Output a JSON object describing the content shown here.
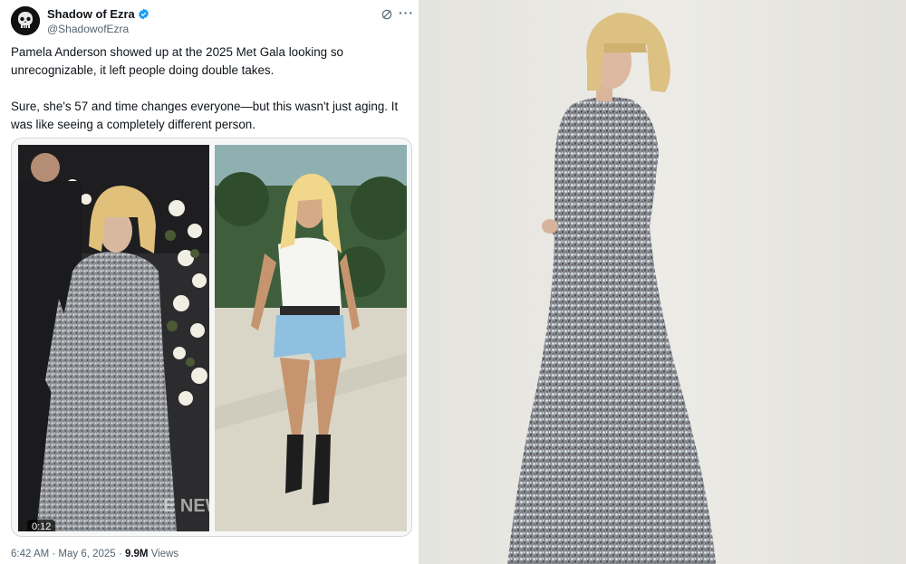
{
  "tweet": {
    "author_name": "Shadow of Ezra",
    "author_handle": "@ShadowofEzra",
    "paragraph_1": "Pamela Anderson showed up at the 2025 Met Gala looking so unrecognizable, it left people doing double takes.",
    "paragraph_2": "Sure, she's 57 and time changes everyone—but this wasn't just aging. It was like seeing a completely different person.",
    "media": {
      "video_duration": "0:12",
      "watermark": "E NEWS"
    },
    "timestamp": "6:42 AM · May 6, 2025",
    "separator": " · ",
    "views_count": "9.9M",
    "views_label": " Views"
  },
  "colors": {
    "verified": "#1d9bf0",
    "text_primary": "#0f1419",
    "text_secondary": "#536471"
  }
}
